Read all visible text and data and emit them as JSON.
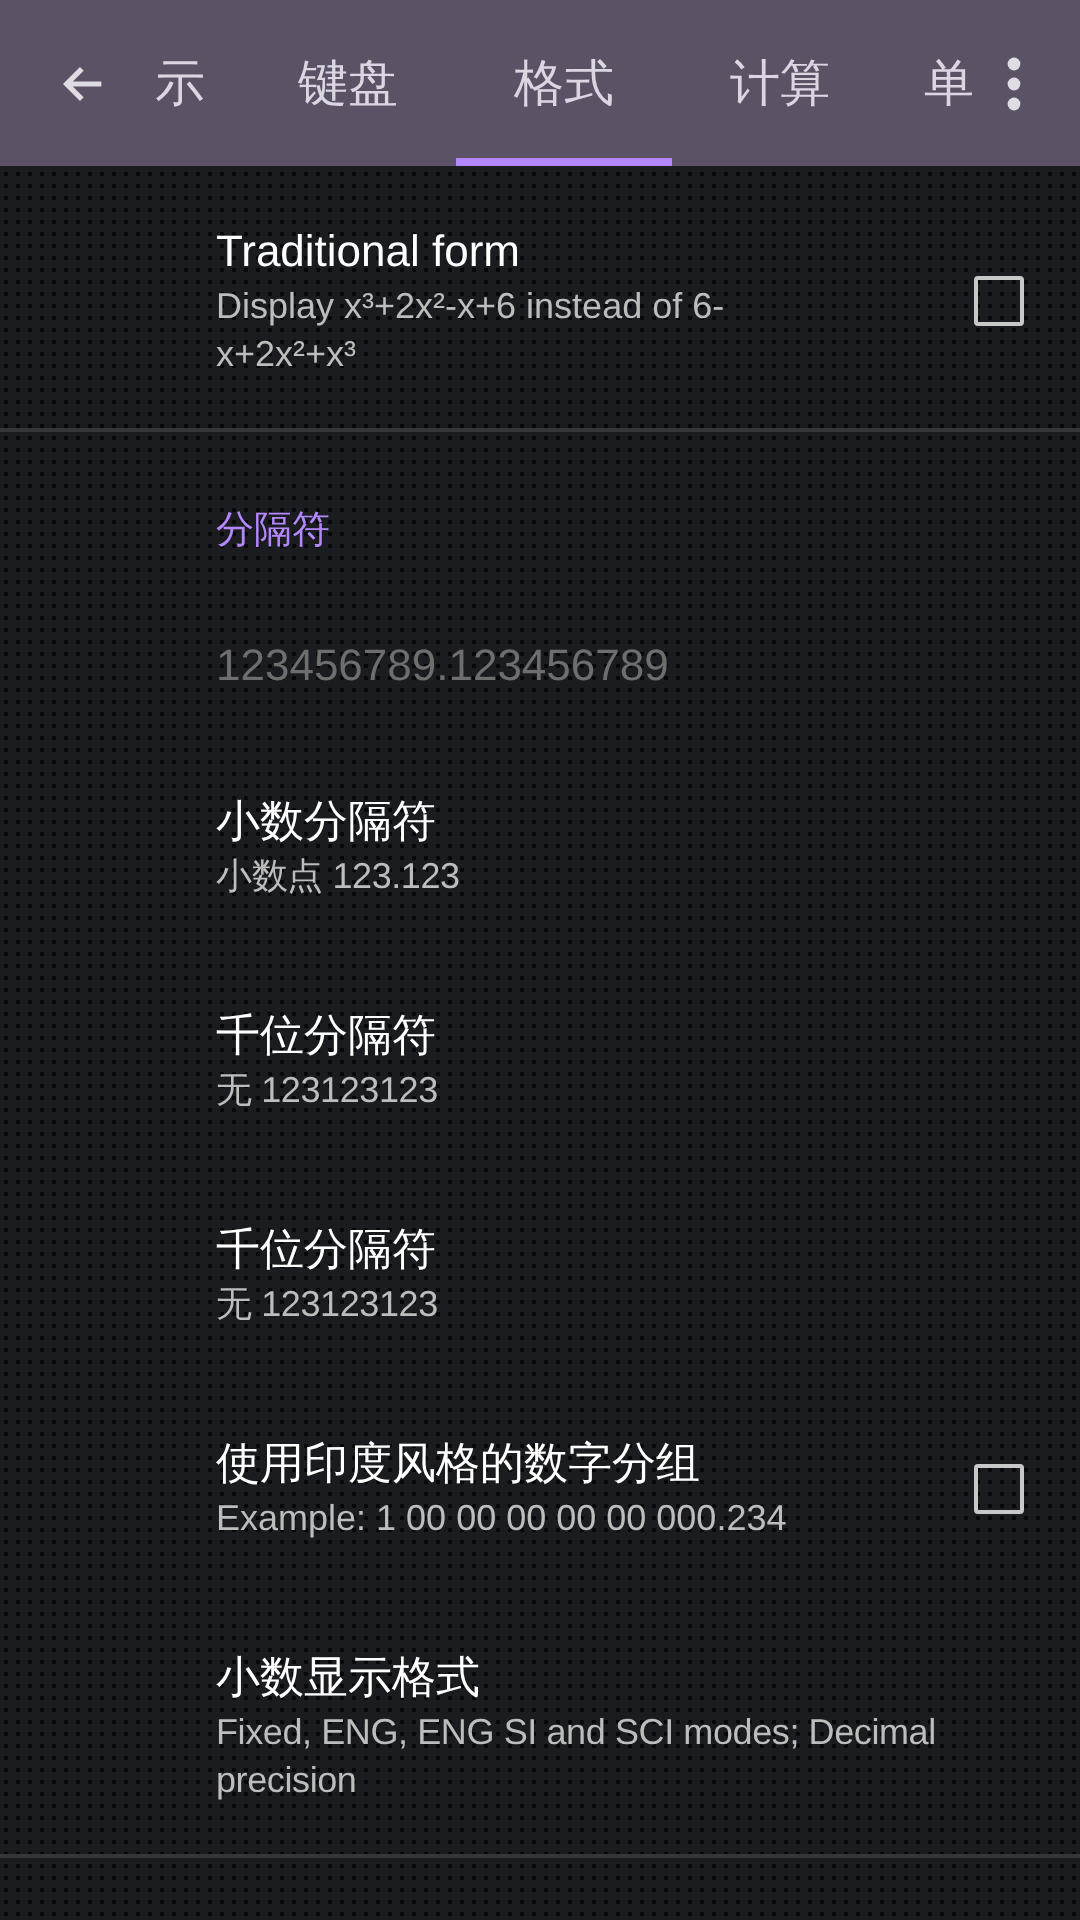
{
  "toolbar": {
    "tabs": [
      {
        "label": "示",
        "selected": false
      },
      {
        "label": "键盘",
        "selected": false
      },
      {
        "label": "格式",
        "selected": true
      },
      {
        "label": "计算",
        "selected": false
      },
      {
        "label": "单",
        "selected": false
      }
    ]
  },
  "preferences": [
    {
      "kind": "setting",
      "title": "Traditional form",
      "summary": "Display x³+2x²-x+6 instead of 6-x+2x²+x³",
      "checked": false,
      "divider": true
    },
    {
      "kind": "category",
      "title": "分隔符"
    },
    {
      "kind": "preview",
      "title": "123456789.123456789"
    },
    {
      "kind": "setting",
      "title": "小数分隔符",
      "summary": "小数点 123.123"
    },
    {
      "kind": "setting",
      "title": "千位分隔符",
      "summary": "无 123123123"
    },
    {
      "kind": "setting",
      "title": "千位分隔符",
      "summary": "无 123123123"
    },
    {
      "kind": "setting",
      "title": "使用印度风格的数字分组",
      "summary": "Example: 1 00 00 00 00 00 000.234",
      "checked": false
    },
    {
      "kind": "setting",
      "title": "小数显示格式",
      "summary": "Fixed, ENG, ENG SI and SCI modes; Decimal precision",
      "divider": true
    }
  ]
}
